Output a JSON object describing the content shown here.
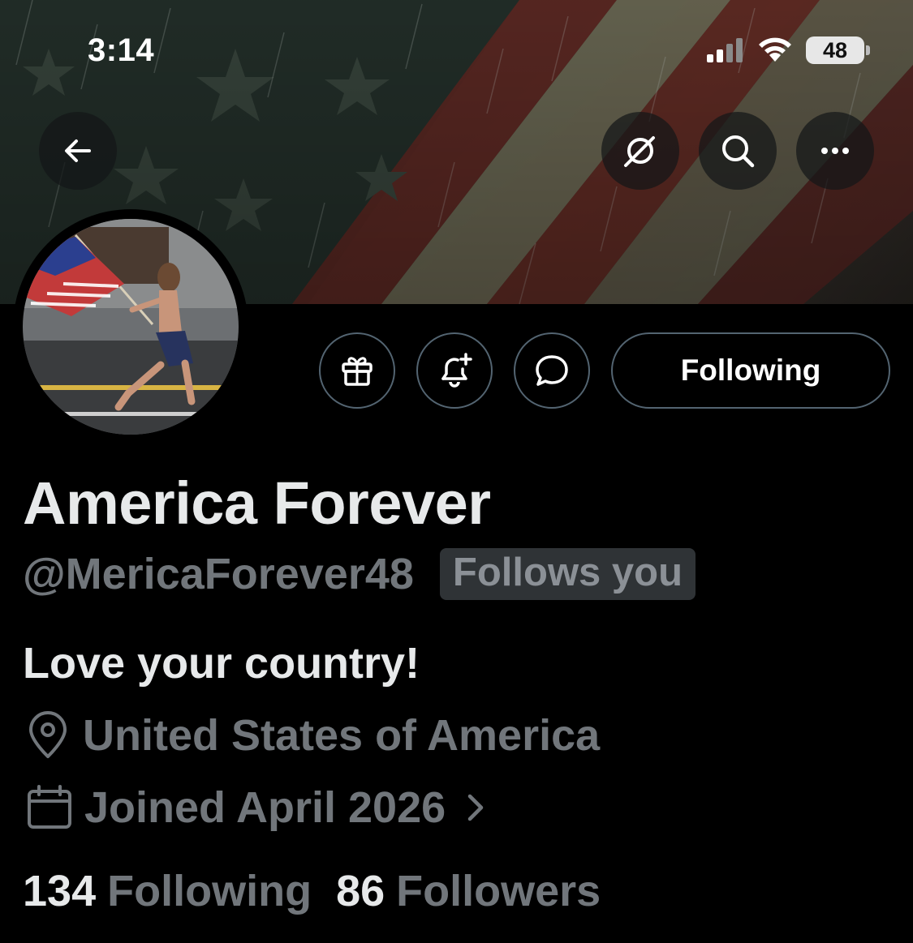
{
  "status_bar": {
    "time": "3:14",
    "battery": "48",
    "icons": [
      "cellular-signal-icon",
      "wifi-icon",
      "battery-icon"
    ]
  },
  "header": {
    "icons": [
      "back-arrow-icon",
      "grok-icon",
      "search-icon",
      "more-icon"
    ]
  },
  "profile": {
    "display_name": "America Forever",
    "handle": "@MericaForever48",
    "follows_you_badge": "Follows you",
    "bio": "Love your country!",
    "location": "United States of America",
    "joined": "Joined April 2026",
    "following_count": "134",
    "following_label": "Following",
    "followers_count": "86",
    "followers_label": "Followers"
  },
  "actions": {
    "icons": [
      "gift-icon",
      "notification-bell-icon",
      "message-icon"
    ],
    "following_button_label": "Following"
  },
  "colors": {
    "background": "#000000",
    "text_primary": "#e7e9ea",
    "text_secondary": "#71767b",
    "button_border": "#536471"
  }
}
